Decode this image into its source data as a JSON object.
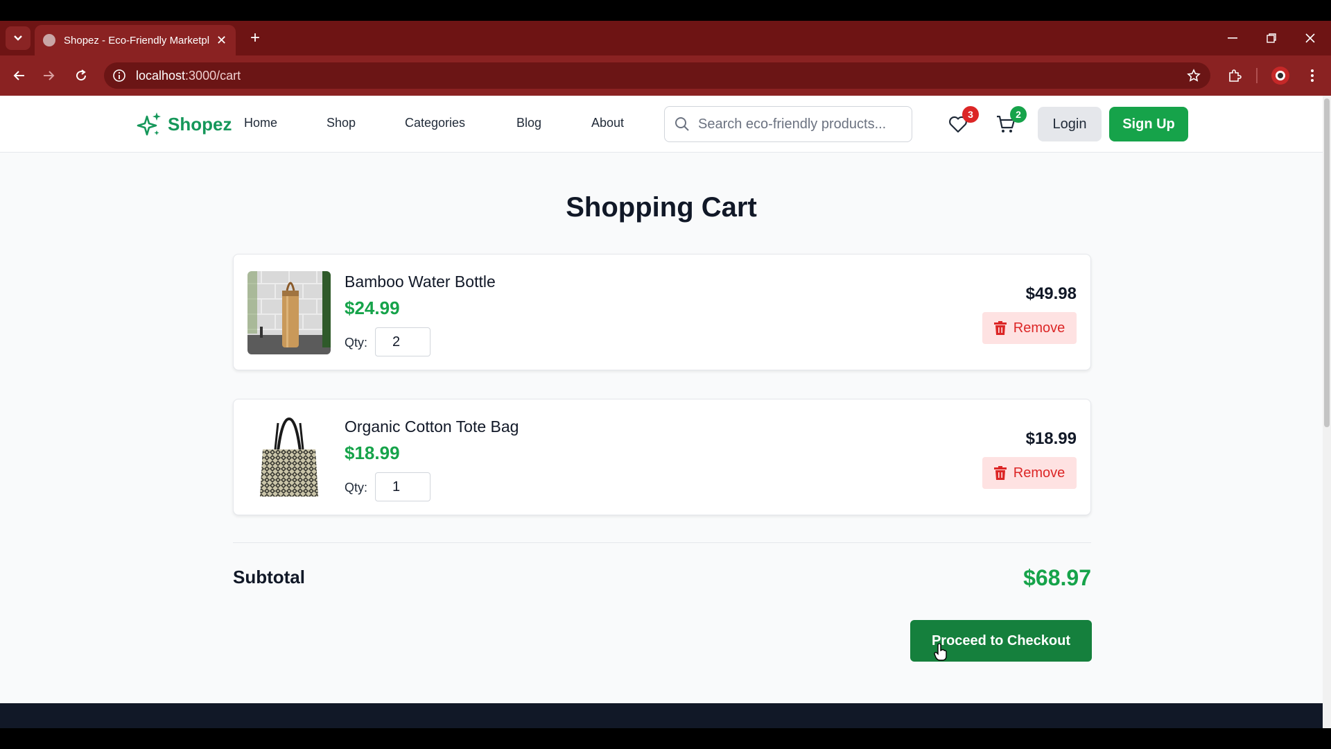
{
  "browser": {
    "tab_title": "Shopez - Eco-Friendly Marketplace",
    "url_host": "localhost",
    "url_path": ":3000/cart"
  },
  "header": {
    "brand": "Shopez",
    "nav": [
      "Home",
      "Shop",
      "Categories",
      "Blog",
      "About"
    ],
    "search_placeholder": "Search eco-friendly products...",
    "wishlist_count": "3",
    "cart_count": "2",
    "login_label": "Login",
    "signup_label": "Sign Up"
  },
  "cart": {
    "title": "Shopping Cart",
    "qty_label": "Qty:",
    "remove_label": "Remove",
    "items": [
      {
        "name": "Bamboo Water Bottle",
        "price": "$24.99",
        "qty": "2",
        "line_total": "$49.98"
      },
      {
        "name": "Organic Cotton Tote Bag",
        "price": "$18.99",
        "qty": "1",
        "line_total": "$18.99"
      }
    ],
    "subtotal_label": "Subtotal",
    "subtotal_value": "$68.97",
    "checkout_label": "Proceed to Checkout"
  },
  "colors": {
    "brand_green": "#16a34a",
    "remove_red": "#dc2626",
    "browser_chrome": "#8a2222"
  },
  "icons": [
    "chevron-down-icon",
    "globe-icon",
    "close-icon",
    "plus-icon",
    "minimize-icon",
    "restore-icon",
    "back-icon",
    "forward-icon",
    "reload-icon",
    "site-info-icon",
    "star-icon",
    "extensions-icon",
    "profile-icon",
    "more-icon",
    "sparkle-logo-icon",
    "search-icon",
    "heart-icon",
    "cart-icon",
    "trash-icon"
  ]
}
